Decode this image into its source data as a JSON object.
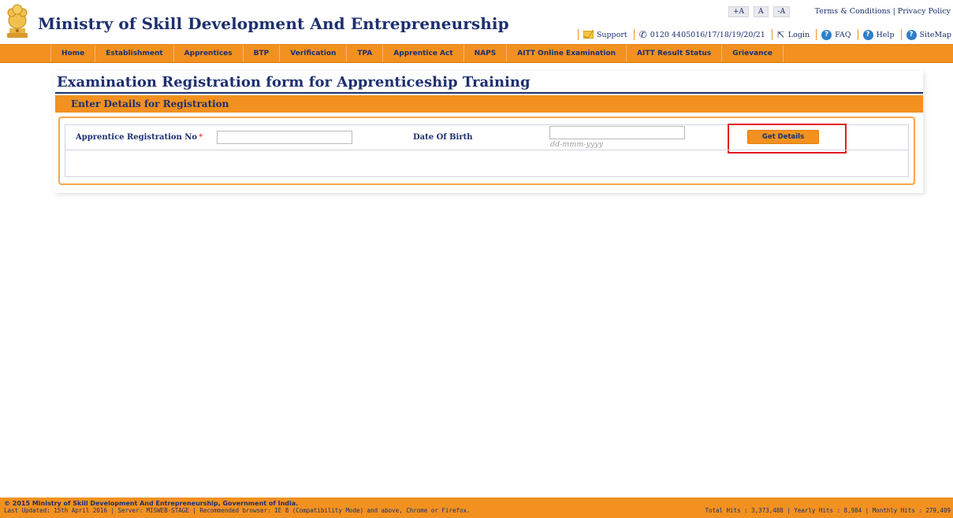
{
  "header": {
    "site_title": "Ministry of Skill Development And Entrepreneurship",
    "font_sizer": [
      "+A",
      "A",
      "-A"
    ],
    "top_links": {
      "terms": "Terms & Conditions",
      "separator": "|",
      "privacy": "Privacy Policy"
    },
    "utility": {
      "support": "Support",
      "phone": "0120 4405016/17/18/19/20/21",
      "login": "Login",
      "faq": "FAQ",
      "help": "Help",
      "sitemap": "SiteMap",
      "help_glyph": "?"
    },
    "icons": {
      "emblem": "national-emblem-icon",
      "support": "mail-icon",
      "phone": "phone-icon",
      "login": "login-icon",
      "faq": "help-circle-icon"
    }
  },
  "nav": {
    "items": [
      "Home",
      "Establishment",
      "Apprentices",
      "BTP",
      "Verification",
      "TPA",
      "Apprentice Act",
      "NAPS",
      "AITT Online Examination",
      "AITT Result Status",
      "Grievance"
    ]
  },
  "page": {
    "title": "Examination Registration form for Apprenticeship Training",
    "section_label": "Enter Details for Registration"
  },
  "form": {
    "reg_no_label": "Apprentice Registration No",
    "required_mark": "*",
    "reg_no_value": "",
    "dob_label": "Date Of Birth",
    "dob_value": "",
    "dob_hint": "dd-mmm-yyyy",
    "get_details_label": "Get Details"
  },
  "footer": {
    "copyright": "© 2015 Ministry of Skill Development And Entrepreneurship, Government of India.",
    "last_updated": "Last Updated: 15th April 2016 | Server: MISWEB-STAGE | Recommended browser: IE 8 (Compatibility Mode) and above, Chrome or Firefox.",
    "hits": "Total Hits : 3,373,488 | Yearly Hits : 8,984 | Monthly Hits : 279,409"
  },
  "colors": {
    "brand_orange": "#f29120",
    "navy": "#1d2f6f",
    "highlight_red": "#e41b23"
  }
}
